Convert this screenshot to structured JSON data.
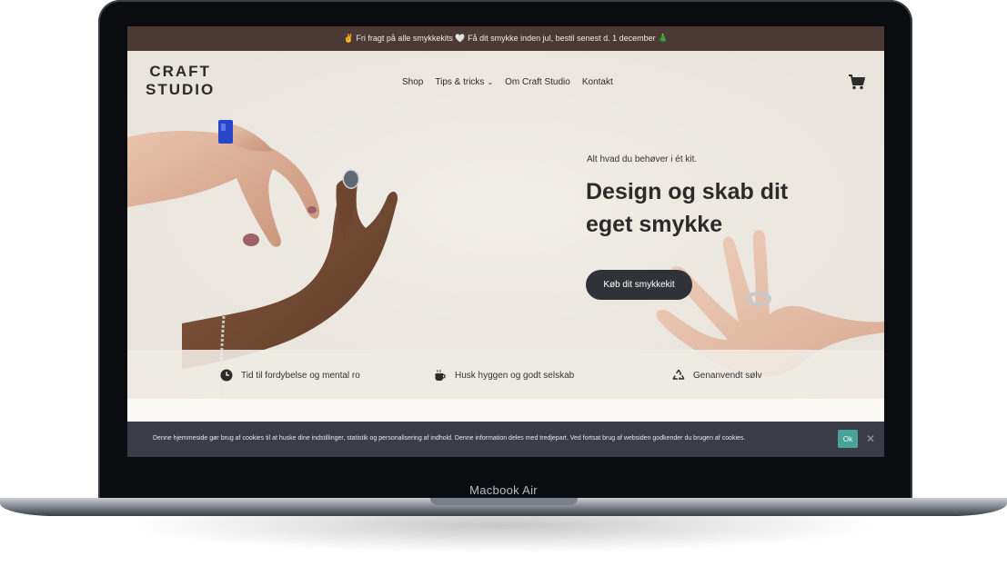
{
  "device": {
    "label": "Macbook Air"
  },
  "announcement": {
    "text": "✌ Fri fragt på alle smykkekits 🤍 Få dit smykke inden jul, bestil senest d. 1 december 🎄"
  },
  "logo": {
    "line1": "CRAFT",
    "line2": "STUDIO"
  },
  "nav": {
    "items": [
      {
        "label": "Shop"
      },
      {
        "label": "Tips & tricks",
        "has_dropdown": true,
        "chevron": "⌄"
      },
      {
        "label": "Om Craft Studio"
      },
      {
        "label": "Kontakt"
      }
    ],
    "cart_icon": "shopping-cart-icon"
  },
  "hero": {
    "tagline": "Alt hvad du behøver i ét kit.",
    "headline": "Design og skab dit eget smykke",
    "cta_label": "Køb dit smykkekit"
  },
  "features": [
    {
      "icon": "clock-icon",
      "label": "Tid til fordybelse og mental ro"
    },
    {
      "icon": "coffee-cup-icon",
      "label": "Husk hyggen og godt selskab"
    },
    {
      "icon": "recycle-icon",
      "label": "Genanvendt sølv"
    }
  ],
  "cookie": {
    "text": "Denne hjemmeside gør brug af cookies til at huske dine indstillinger, statistik og personalisering af indhold. Denne information deles med tredjepart. Ved fortsat brug af websiden godkender du brugen af cookies.",
    "ok_label": "Ok",
    "close_label": "✕"
  },
  "colors": {
    "announcement_bg": "#4a3934",
    "hero_bg": "#f0ece6",
    "cta_bg": "#2f3337",
    "cookie_bg": "#3a3d45",
    "cookie_ok_bg": "#47a39a"
  }
}
